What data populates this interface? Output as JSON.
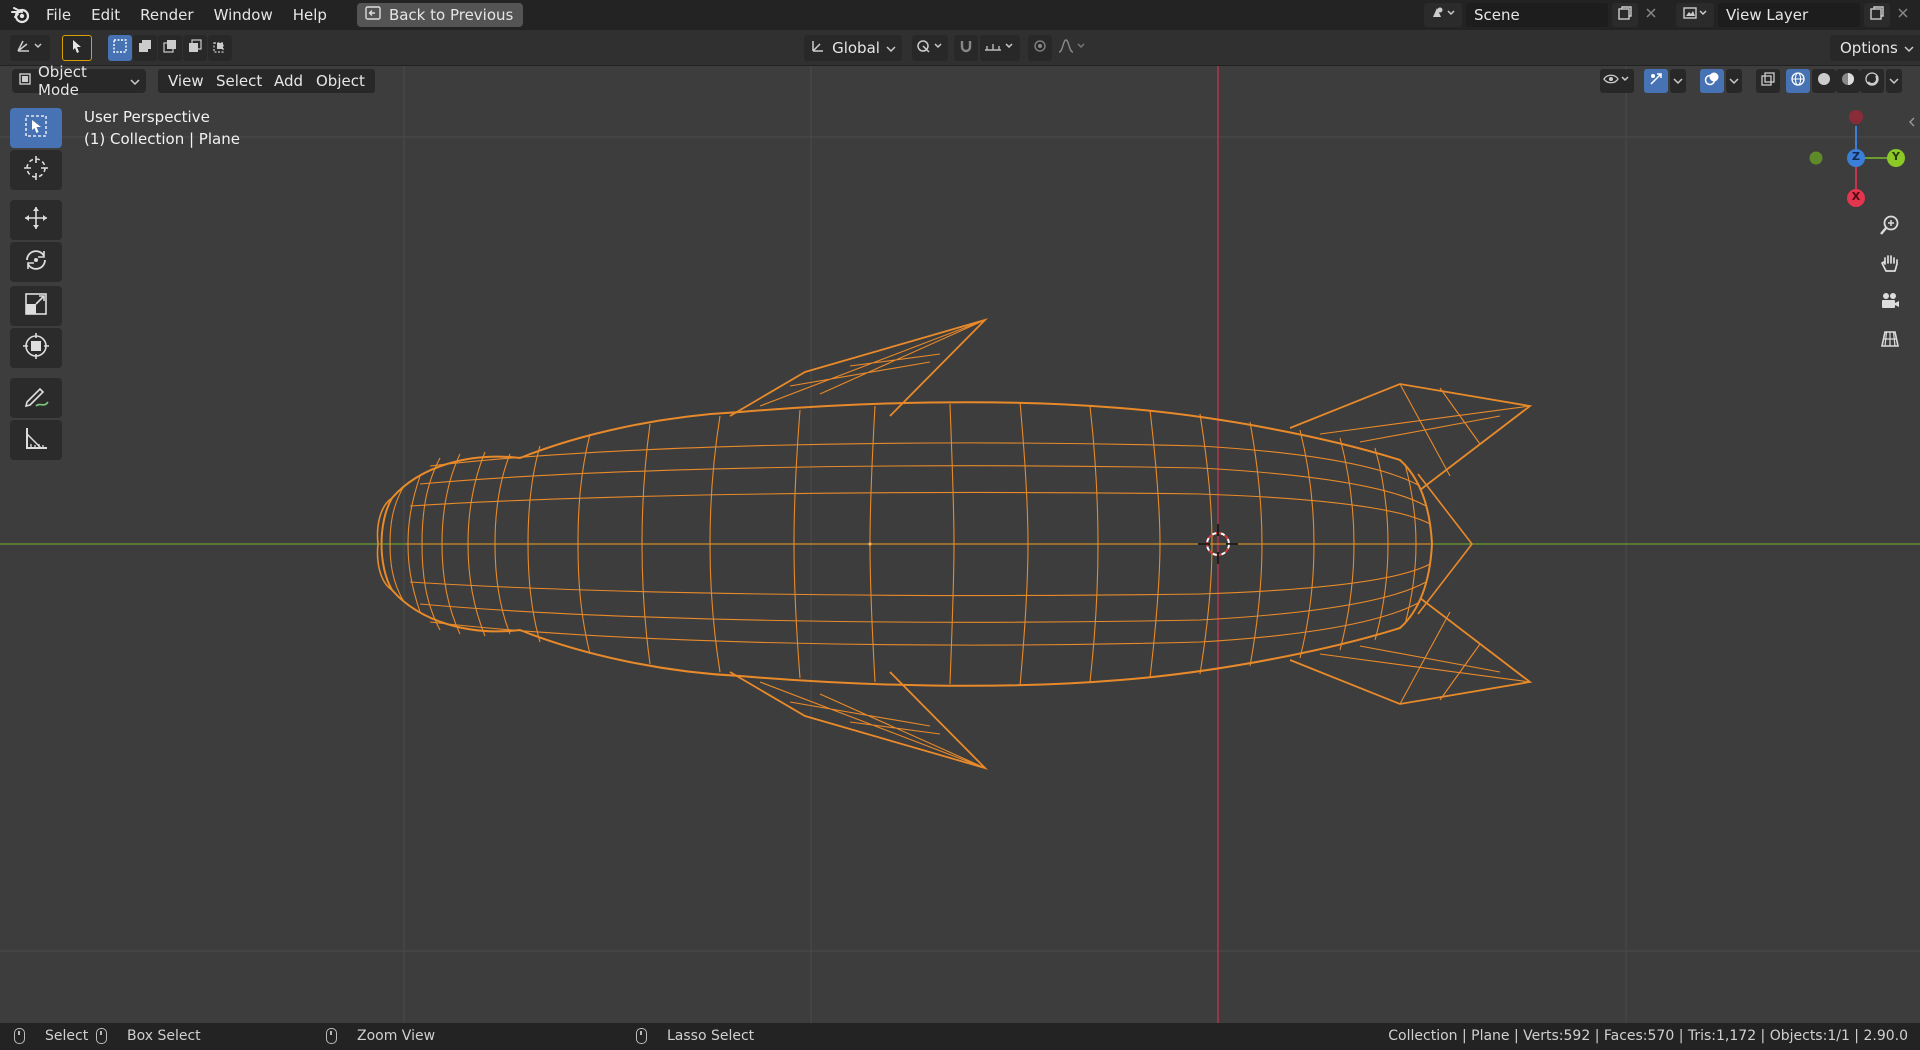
{
  "topbar": {
    "menus": [
      "File",
      "Edit",
      "Render",
      "Window",
      "Help"
    ],
    "back_label": "Back to Previous",
    "scene_name": "Scene",
    "view_layer_name": "View Layer"
  },
  "toolbar": {
    "transform_orientation": "Global",
    "options_label": "Options"
  },
  "viewport_header": {
    "mode": "Object Mode",
    "menus": [
      "View",
      "Select",
      "Add",
      "Object"
    ]
  },
  "viewport": {
    "perspective_label": "User Perspective",
    "collection_label": "(1) Collection | Plane",
    "gizmo": {
      "z": "Z",
      "y": "Y",
      "x": "X"
    }
  },
  "statusbar": {
    "select": "Select",
    "box_select": "Box Select",
    "zoom_view": "Zoom View",
    "lasso_select": "Lasso Select",
    "stats": "Collection | Plane | Verts:592 | Faces:570 | Tris:1,172 | Objects:1/1 | 2.90.0"
  },
  "colors": {
    "accent": "#4772b3",
    "wire_selected": "#f0972c",
    "axis_x": "#c4364f",
    "axis_y": "#6b9b2e",
    "axis_z": "#3b7fd9"
  }
}
